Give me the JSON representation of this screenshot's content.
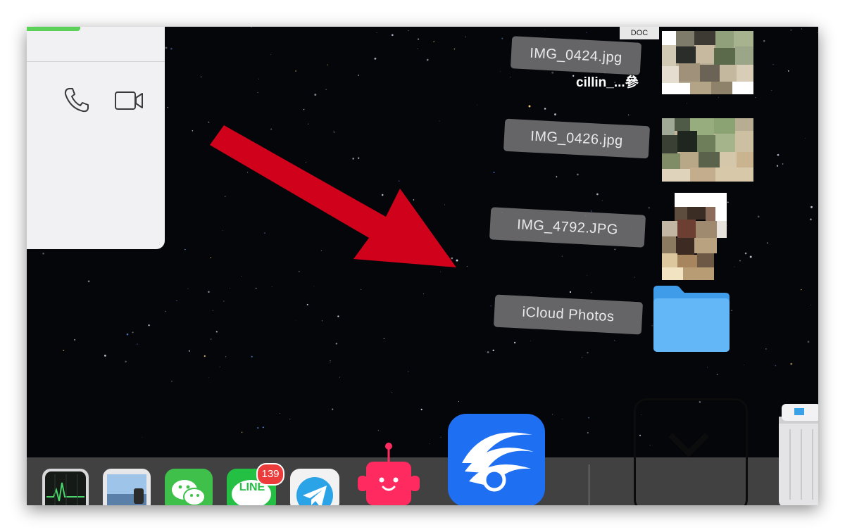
{
  "facetime_panel": {
    "phone_icon": "phone-icon",
    "video_icon": "video-camera-icon",
    "accent_color": "#5bd15a"
  },
  "desktop": {
    "top_tag": "DOC",
    "user_label": "cillin_...參",
    "files": [
      {
        "name": "IMG_0424.jpg"
      },
      {
        "name": "IMG_0426.jpg"
      },
      {
        "name": "IMG_4792.JPG"
      },
      {
        "name": "iCloud Photos"
      }
    ],
    "arrow_color": "#d0021b"
  },
  "dock": {
    "apps": [
      {
        "icon": "activity-monitor-icon"
      },
      {
        "icon": "preview-icon"
      },
      {
        "icon": "wechat-icon"
      },
      {
        "icon": "line-icon",
        "badge": "139",
        "text": "LINE"
      },
      {
        "icon": "telegram-icon"
      },
      {
        "icon": "robot-app-icon"
      },
      {
        "icon": "eye-app-icon"
      }
    ],
    "trash_icon": "trash-icon"
  }
}
